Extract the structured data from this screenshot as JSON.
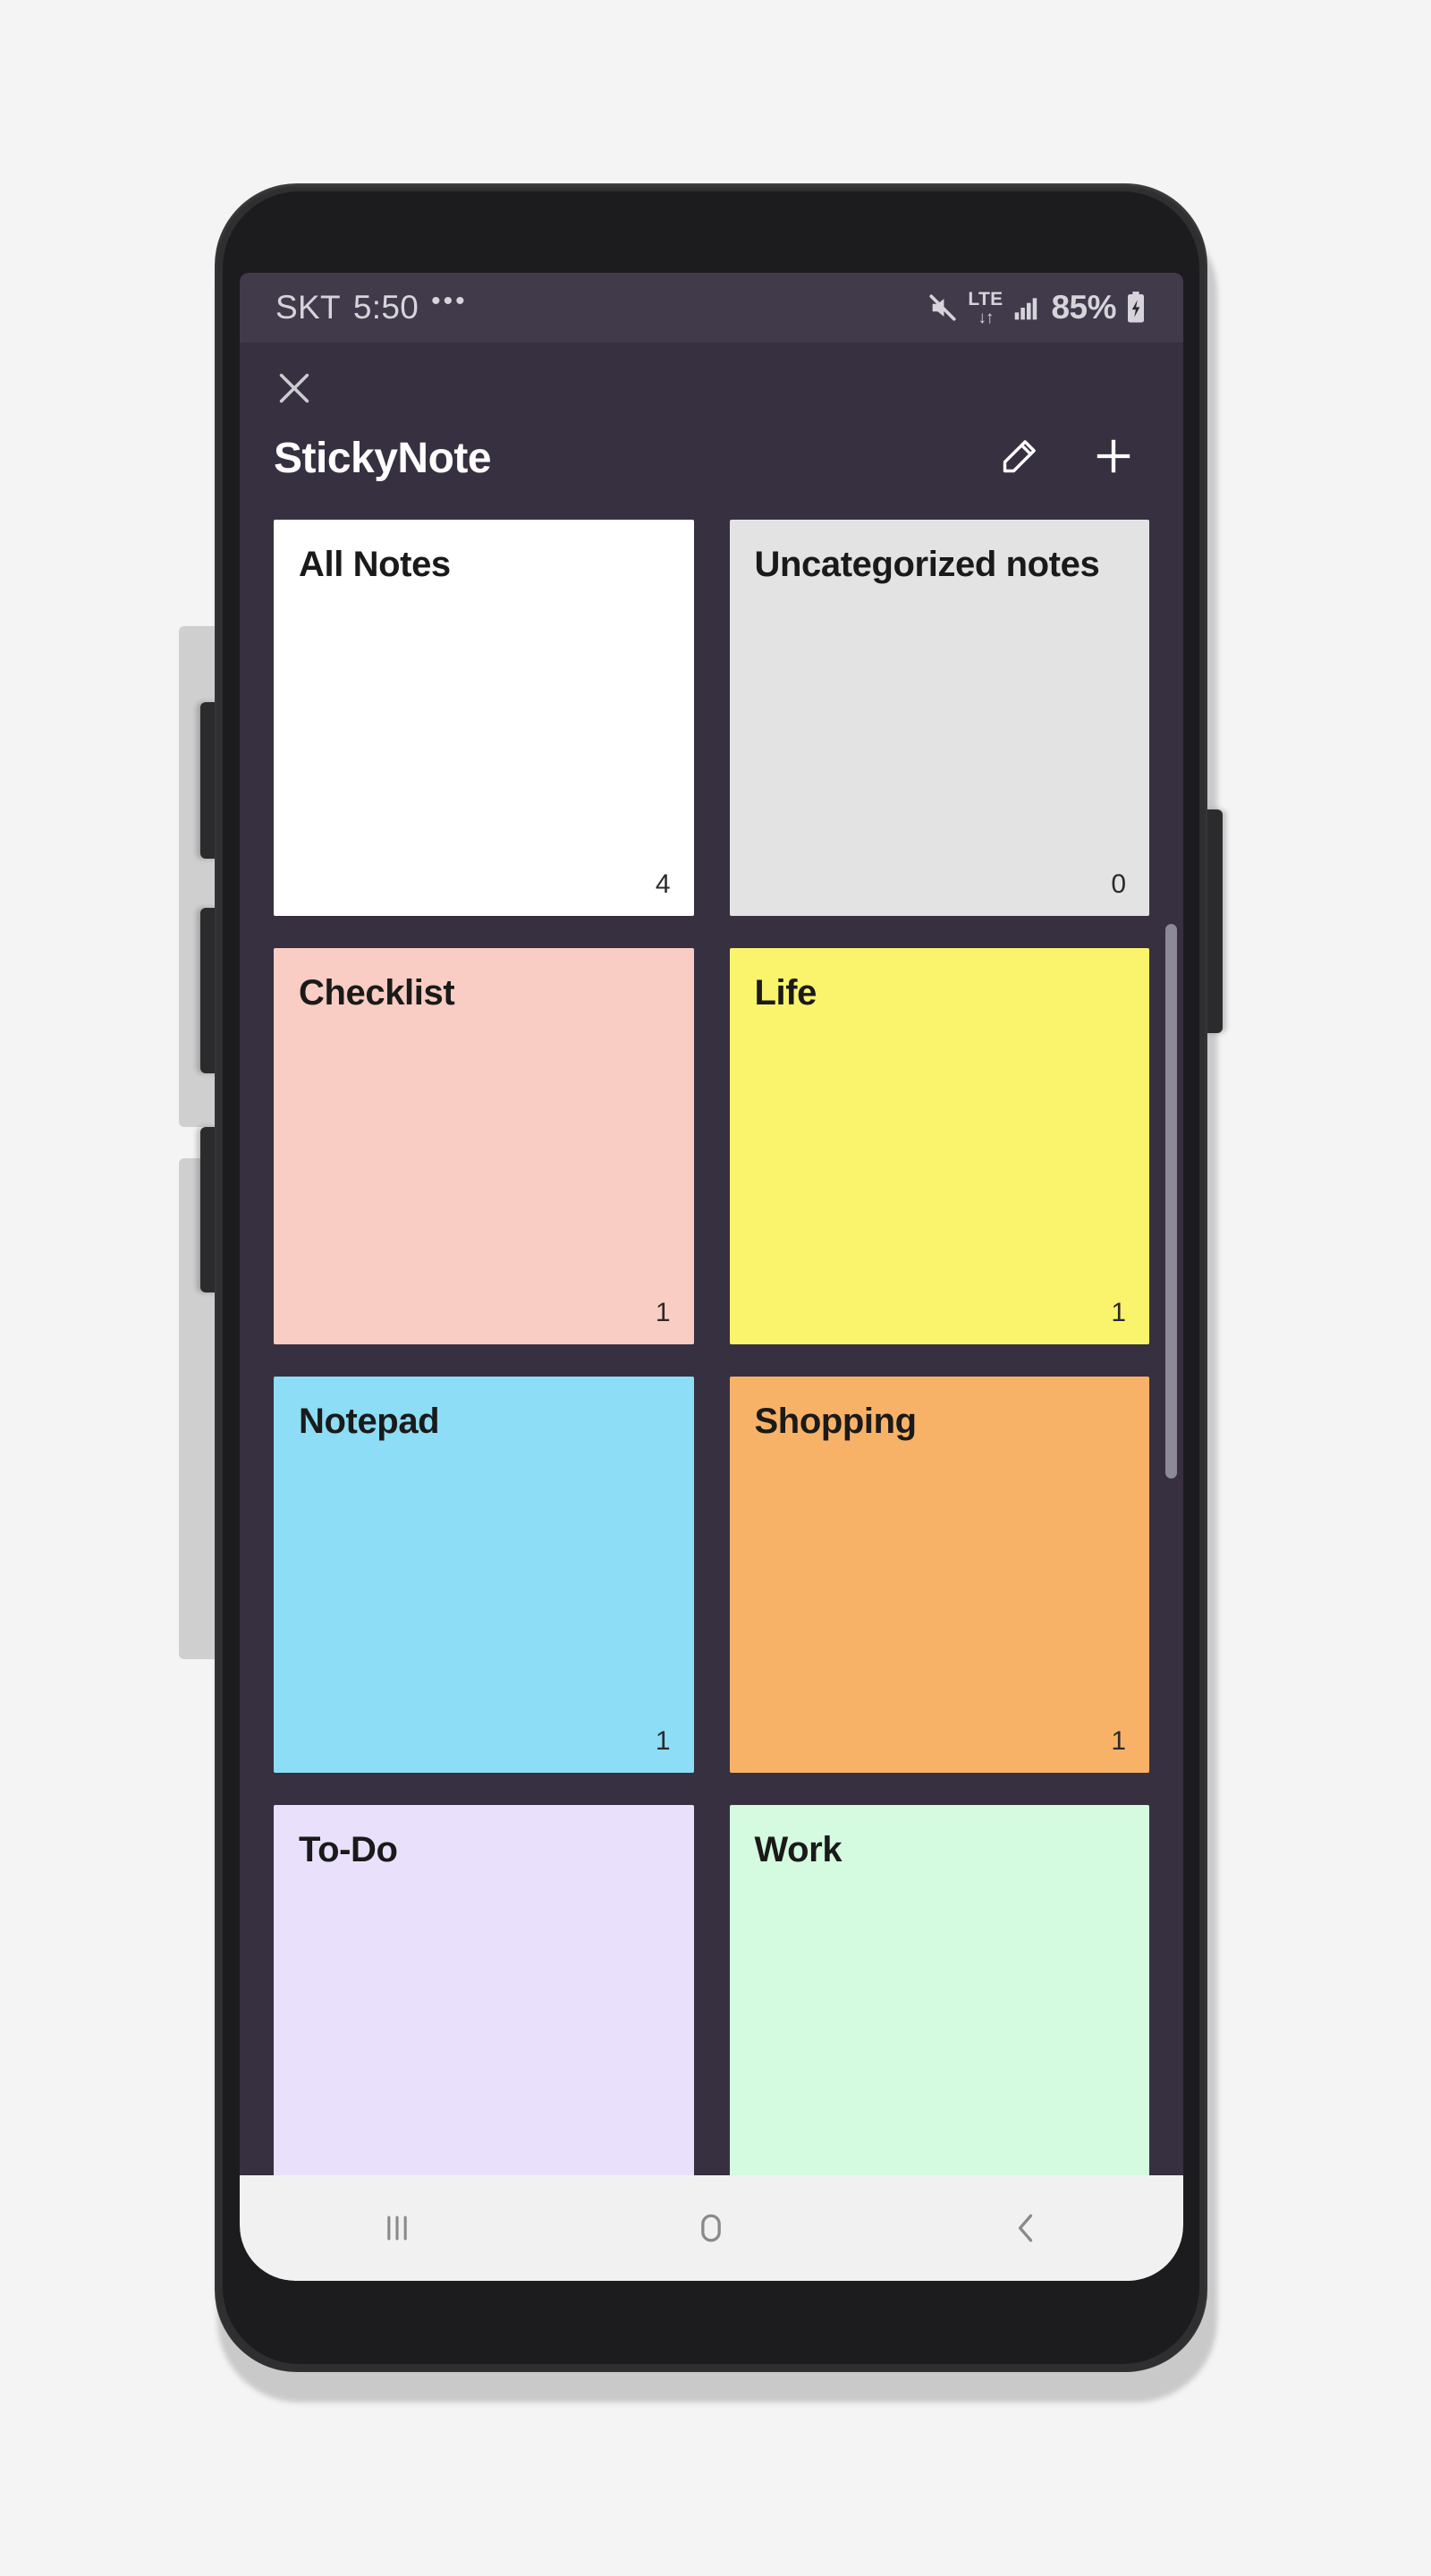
{
  "status_bar": {
    "carrier": "SKT",
    "time": "5:50",
    "overflow_dots": "•••",
    "mute_icon": "mute-icon",
    "network_label": "LTE",
    "network_arrows": "↓↑",
    "signal_icon": "signal-bars-icon",
    "battery_percent": "85%",
    "battery_icon": "battery-charging-icon",
    "text_color": "#d6d4da",
    "bg_color": "#403a4b"
  },
  "header": {
    "close_icon": "close-icon",
    "title": "StickyNote",
    "edit_icon": "pencil-icon",
    "add_icon": "plus-icon",
    "title_color": "#ffffff"
  },
  "app": {
    "background_color": "#373040"
  },
  "notes": {
    "cards": [
      {
        "title": "All Notes",
        "count": "4",
        "color": "#ffffff"
      },
      {
        "title": "Uncategorized notes",
        "count": "0",
        "color": "#e3e3e3"
      },
      {
        "title": "Checklist",
        "count": "1",
        "color": "#f9cdc3"
      },
      {
        "title": "Life",
        "count": "1",
        "color": "#faf46d"
      },
      {
        "title": "Notepad",
        "count": "1",
        "color": "#8cddf5"
      },
      {
        "title": "Shopping",
        "count": "1",
        "color": "#f8b268"
      },
      {
        "title": "To-Do",
        "count": "",
        "color": "#e9e1fc"
      },
      {
        "title": "Work",
        "count": "",
        "color": "#d4fadf"
      }
    ]
  },
  "scrollbar": {
    "thumb_color": "#8c8a99"
  },
  "nav_bar": {
    "recents_icon": "recents-icon",
    "home_icon": "home-icon",
    "back_icon": "back-icon",
    "bg_color": "#f1f1f1",
    "icon_color": "#8a8a8a"
  }
}
